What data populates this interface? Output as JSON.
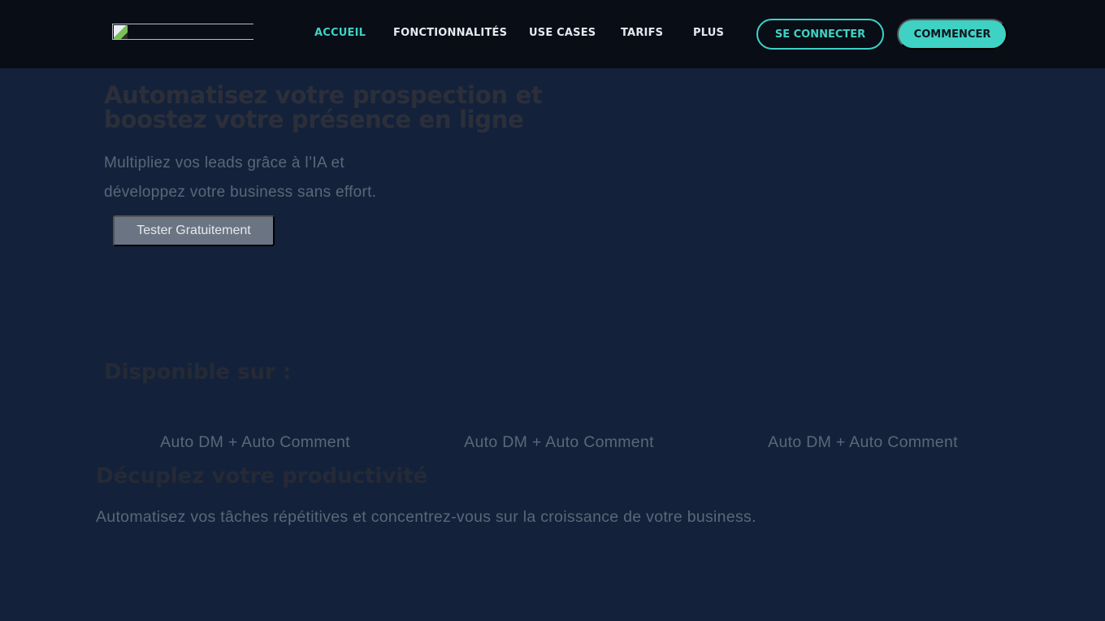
{
  "header": {
    "logo_alt": "",
    "nav": [
      {
        "label": "ACCUEIL",
        "active": true
      },
      {
        "label": "FONCTIONNALITÉS",
        "active": false
      },
      {
        "label": "USE CASES",
        "active": false
      },
      {
        "label": "TARIFS",
        "active": false
      },
      {
        "label": "PLUS",
        "active": false
      }
    ],
    "login_label": "SE CONNECTER",
    "start_label": "COMMENCER"
  },
  "hero": {
    "title": "Automatisez votre prospection et boostez votre présence en ligne",
    "subtitle": "Multipliez vos leads grâce à l’IA et développez votre business sans effort.",
    "cta_label": "Tester Gratuitement"
  },
  "available": {
    "title": "Disponible sur :",
    "features": [
      "Auto DM + Auto Comment",
      "Auto DM + Auto Comment",
      "Auto DM + Auto Comment"
    ]
  },
  "productivity": {
    "title": "Décuplez votre productivité",
    "subtitle": "Automatisez vos tâches répétitives et concentrez-vous sur la croissance de votre business."
  },
  "colors": {
    "accent": "#3fd2c4",
    "header_bg": "#080d16",
    "page_bg": "#13223a",
    "cta_bg": "#6b7482"
  }
}
